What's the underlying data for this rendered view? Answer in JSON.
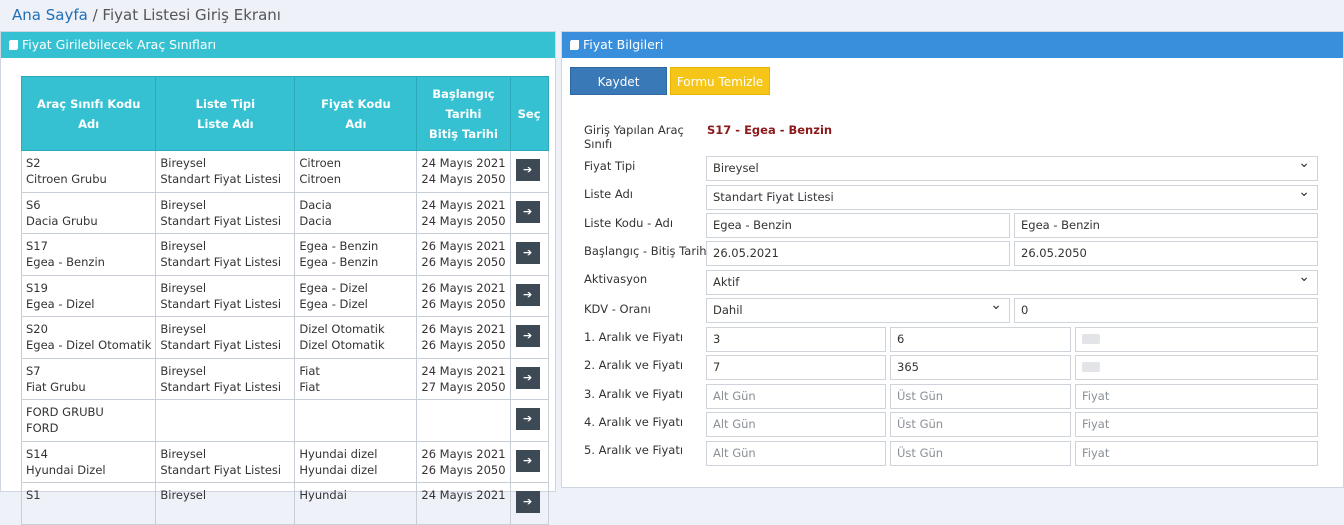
{
  "breadcrumb": {
    "home": "Ana Sayfa",
    "separator": "/",
    "current": "Fiyat Listesi Giriş Ekranı"
  },
  "left_panel": {
    "title": "Fiyat Girilebilecek Araç Sınıfları",
    "headers": {
      "col1": [
        "Araç Sınıfı Kodu",
        "Adı"
      ],
      "col2": [
        "Liste Tipi",
        "Liste Adı"
      ],
      "col3": [
        "Fiyat Kodu",
        "Adı"
      ],
      "col4": [
        "Başlangıç",
        "Tarihi",
        "Bitiş Tarihi"
      ],
      "col5": "Seç"
    },
    "rows": [
      {
        "code": "S2",
        "name": "Citroen Grubu",
        "type": "Bireysel",
        "list": "Standart Fiyat Listesi",
        "pcode": "Citroen",
        "pname": "Citroen",
        "start": "24 Mayıs 2021",
        "end": "24 Mayıs 2050"
      },
      {
        "code": "S6",
        "name": "Dacia Grubu",
        "type": "Bireysel",
        "list": "Standart Fiyat Listesi",
        "pcode": "Dacia",
        "pname": "Dacia",
        "start": "24 Mayıs 2021",
        "end": "24 Mayıs 2050"
      },
      {
        "code": "S17",
        "name": "Egea - Benzin",
        "type": "Bireysel",
        "list": "Standart Fiyat Listesi",
        "pcode": "Egea - Benzin",
        "pname": "Egea - Benzin",
        "start": "26 Mayıs 2021",
        "end": "26 Mayıs 2050"
      },
      {
        "code": "S19",
        "name": "Egea - Dizel",
        "type": "Bireysel",
        "list": "Standart Fiyat Listesi",
        "pcode": "Egea - Dizel",
        "pname": "Egea - Dizel",
        "start": "26 Mayıs 2021",
        "end": "26 Mayıs 2050"
      },
      {
        "code": "S20",
        "name": "Egea - Dizel Otomatik",
        "type": "Bireysel",
        "list": "Standart Fiyat Listesi",
        "pcode": "Dizel Otomatik",
        "pname": "Dizel Otomatik",
        "start": "26 Mayıs 2021",
        "end": "26 Mayıs 2050"
      },
      {
        "code": "S7",
        "name": "Fiat Grubu",
        "type": "Bireysel",
        "list": "Standart Fiyat Listesi",
        "pcode": "Fiat",
        "pname": "Fiat",
        "start": "24 Mayıs 2021",
        "end": "27 Mayıs 2050"
      },
      {
        "code": "FORD GRUBU",
        "name": "FORD",
        "type": "",
        "list": "",
        "pcode": "",
        "pname": "",
        "start": "",
        "end": ""
      },
      {
        "code": "S14",
        "name": "Hyundai Dizel",
        "type": "Bireysel",
        "list": "Standart Fiyat Listesi",
        "pcode": "Hyundai dizel",
        "pname": "Hyundai dizel",
        "start": "26 Mayıs 2021",
        "end": "26 Mayıs 2050"
      },
      {
        "code": "S1",
        "name": "",
        "type": "Bireysel",
        "list": "",
        "pcode": "Hyundai",
        "pname": "",
        "start": "24 Mayıs 2021",
        "end": ""
      }
    ],
    "select_icon": "arrow-right-icon"
  },
  "right_panel": {
    "title": "Fiyat Bilgileri",
    "buttons": {
      "save": "Kaydet",
      "clear": "Formu Temizle"
    },
    "labels": {
      "vehicle_class": [
        "Giriş Yapılan Araç",
        "Sınıfı"
      ],
      "price_type": "Fiyat Tipi",
      "list_name": "Liste Adı",
      "list_code": "Liste Kodu - Adı",
      "dates": "Başlangıç - Bitiş Tarihi",
      "activation": "Aktivasyon",
      "vat": "KDV - Oranı",
      "range1": "1. Aralık ve Fiyatı",
      "range2": "2. Aralık ve Fiyatı",
      "range3": "3. Aralık ve Fiyatı",
      "range4": "4. Aralık ve Fiyatı",
      "range5": "5. Aralık ve Fiyatı"
    },
    "values": {
      "vehicle_class": "S17 - Egea - Benzin",
      "price_type": "Bireysel",
      "list_name": "Standart Fiyat Listesi",
      "list_code": "Egea - Benzin",
      "list_code_name": "Egea - Benzin",
      "start_date": "26.05.2021",
      "end_date": "26.05.2050",
      "activation": "Aktif",
      "vat": "Dahil",
      "vat_rate": "0",
      "r1_low": "3",
      "r1_high": "6",
      "r2_low": "7",
      "r2_high": "365"
    },
    "placeholders": {
      "low": "Alt Gün",
      "high": "Üst Gün",
      "price": "Fiyat"
    }
  }
}
